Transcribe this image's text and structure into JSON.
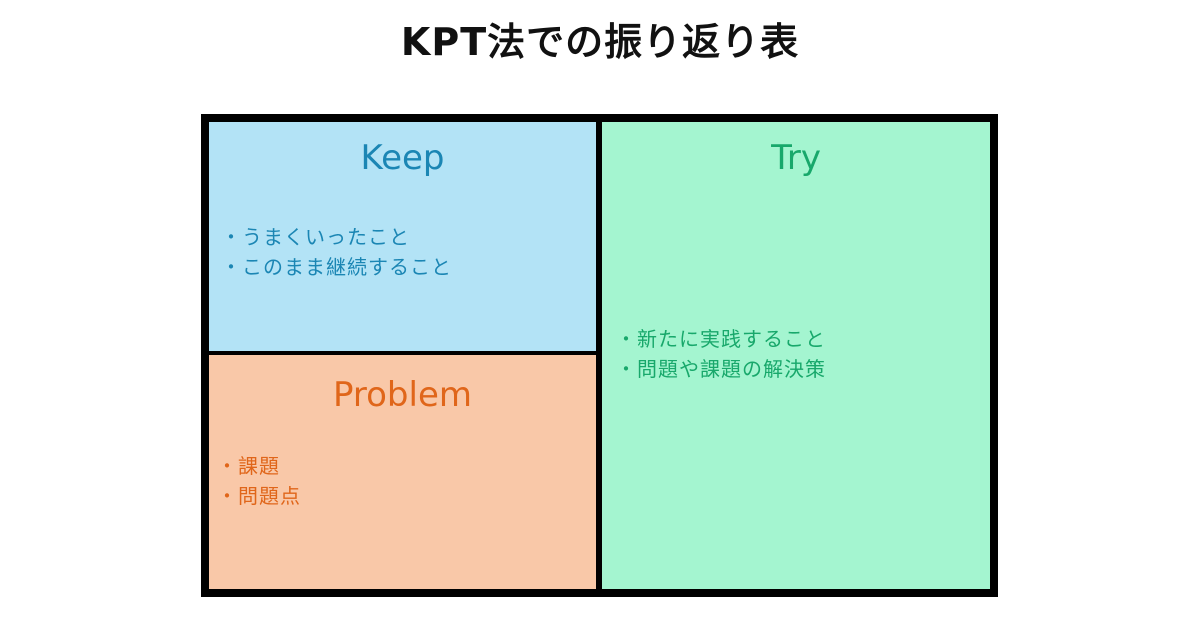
{
  "title": "KPT法での振り返り表",
  "colors": {
    "keep_bg": "#b3e3f6",
    "keep_text": "#1b86b4",
    "problem_bg": "#f9c8a8",
    "problem_text": "#e0661a",
    "try_bg": "#a4f5d0",
    "try_text": "#18a86b",
    "border": "#000000"
  },
  "keep": {
    "heading": "Keep",
    "items": [
      "・うまくいったこと",
      "・このまま継続すること"
    ]
  },
  "problem": {
    "heading": "Problem",
    "items": [
      "・課題",
      "・問題点"
    ]
  },
  "try": {
    "heading": "Try",
    "items": [
      "・新たに実践すること",
      "・問題や課題の解決策"
    ]
  }
}
